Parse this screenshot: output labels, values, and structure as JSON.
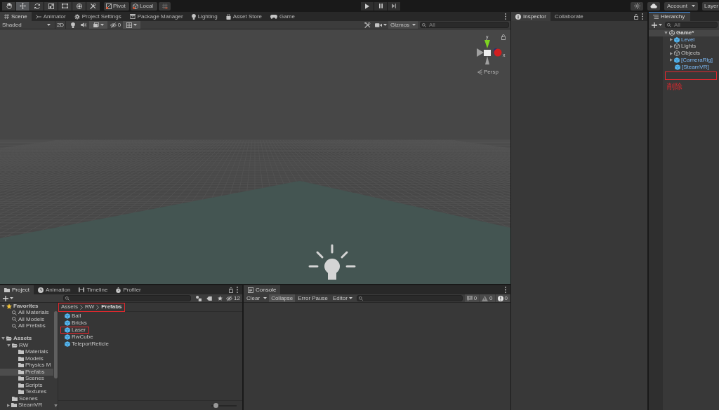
{
  "toolbar": {
    "tools": [
      {
        "kind": "hand",
        "selected": false
      },
      {
        "kind": "move",
        "selected": true
      },
      {
        "kind": "rotate",
        "selected": false
      },
      {
        "kind": "scale",
        "selected": false
      },
      {
        "kind": "rect",
        "selected": false
      },
      {
        "kind": "transform",
        "selected": false
      },
      {
        "kind": "custom",
        "selected": false
      }
    ],
    "pivot": "Pivot",
    "space": "Local",
    "account": "Account",
    "layers": "Layer"
  },
  "scene_panel": {
    "tabs": [
      {
        "label": "Scene",
        "kind": "scene",
        "selected": true
      },
      {
        "label": "Animator",
        "kind": "animator",
        "selected": false
      },
      {
        "label": "Project Settings",
        "kind": "gear",
        "selected": false
      },
      {
        "label": "Package Manager",
        "kind": "package",
        "selected": false
      },
      {
        "label": "Lighting",
        "kind": "bulb",
        "selected": false
      },
      {
        "label": "Asset Store",
        "kind": "bag",
        "selected": false
      },
      {
        "label": "Game",
        "kind": "gamepad",
        "selected": false
      }
    ],
    "toolbar": {
      "shading": "Shaded",
      "mode_2d": {
        "label": "2D",
        "on": false
      },
      "toggles": [
        {
          "kind": "lighting",
          "on": false
        },
        {
          "kind": "audio",
          "on": false
        },
        {
          "kind": "effects",
          "on": true
        }
      ],
      "hidden_count": "0",
      "grid": {
        "on": true
      },
      "gizmos": "Gizmos",
      "search": {
        "placeholder": "All"
      }
    },
    "view": {
      "axes": [
        "y",
        "x"
      ],
      "projection": "Persp"
    }
  },
  "inspector_panel": {
    "tabs": [
      {
        "label": "Inspector",
        "kind": "info",
        "selected": true
      },
      {
        "label": "Collaborate",
        "kind": "plain",
        "selected": false
      }
    ]
  },
  "hierarchy_panel": {
    "tab": {
      "label": "Hierarchy",
      "selected": true,
      "focused": true
    },
    "search": {
      "placeholder": "All"
    },
    "scene": {
      "name": "Game*",
      "expanded": true,
      "children": [
        {
          "name": "Level",
          "kind": "prefab",
          "expanded": false
        },
        {
          "name": "Lights",
          "kind": "object",
          "expanded": false
        },
        {
          "name": "Objects",
          "kind": "object",
          "expanded": false
        },
        {
          "name": "[CameraRig]",
          "kind": "prefab",
          "expanded": false
        },
        {
          "name": "[SteamVR]",
          "kind": "prefab"
        }
      ]
    },
    "annotation": {
      "text": "削除"
    }
  },
  "project_panel": {
    "tabs": [
      {
        "label": "Project",
        "kind": "folder",
        "selected": true
      },
      {
        "label": "Animation",
        "kind": "clock",
        "selected": false
      },
      {
        "label": "Timeline",
        "kind": "timeline",
        "selected": false
      },
      {
        "label": "Profiler",
        "kind": "profiler",
        "selected": false
      }
    ],
    "hidden_count": "12",
    "favorites": {
      "label": "Favorites",
      "expanded": true,
      "items": [
        {
          "name": "All Materials",
          "selected": false
        },
        {
          "name": "All Models",
          "selected": false
        },
        {
          "name": "All Prefabs",
          "selected": false
        }
      ]
    },
    "assets": {
      "label": "Assets",
      "expanded": true,
      "children": [
        {
          "label": "RW",
          "expanded": true,
          "selected": false,
          "children": [
            {
              "label": "Materials",
              "selected": false
            },
            {
              "label": "Models",
              "selected": false
            },
            {
              "label": "Physics M",
              "selected": false
            },
            {
              "label": "Prefabs",
              "selected": true
            },
            {
              "label": "Scenes",
              "selected": false
            },
            {
              "label": "Scripts",
              "selected": false
            },
            {
              "label": "Textures",
              "selected": false
            }
          ]
        },
        {
          "label": "Scenes",
          "selected": false
        },
        {
          "label": "SteamVR",
          "expanded": false,
          "selected": false
        }
      ]
    },
    "breadcrumb": {
      "parts": [
        "Assets",
        "RW",
        "Prefabs"
      ],
      "highlighted": true
    },
    "items": [
      {
        "name": "Ball",
        "highlighted": false
      },
      {
        "name": "Bricks",
        "highlighted": false
      },
      {
        "name": "Laser",
        "highlighted": true
      },
      {
        "name": "RwCube",
        "highlighted": false
      },
      {
        "name": "TeleportReticle",
        "highlighted": false
      }
    ],
    "zoom_slider": {
      "level": 0.1
    }
  },
  "console_panel": {
    "tab": {
      "label": "Console",
      "selected": true
    },
    "clear": "Clear",
    "toggles": [
      {
        "label": "Collapse",
        "on": true
      },
      {
        "label": "Error Pause",
        "on": false
      }
    ],
    "editor": "Editor",
    "counts": [
      {
        "kind": "info",
        "count": "0"
      },
      {
        "kind": "warning",
        "count": "0"
      },
      {
        "kind": "error",
        "count": "0"
      }
    ]
  }
}
